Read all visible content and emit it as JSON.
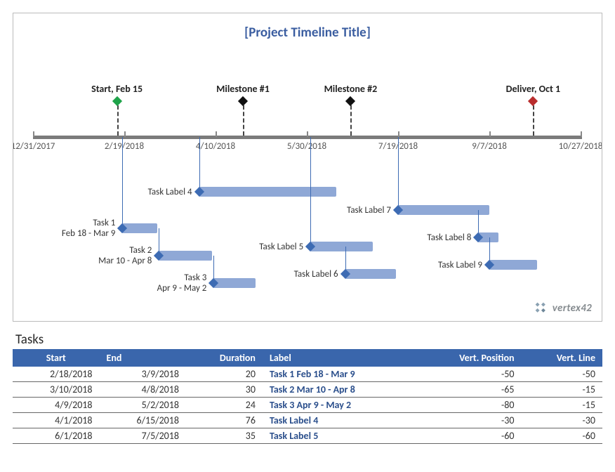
{
  "chart": {
    "title": "[Project Timeline Title]"
  },
  "chart_data": {
    "type": "bar",
    "title": "[Project Timeline Title]",
    "x_axis": {
      "min": "12/31/2017",
      "max": "10/27/2018",
      "ticks": [
        "12/31/2017",
        "2/19/2018",
        "4/10/2018",
        "5/30/2018",
        "7/19/2018",
        "9/7/2018",
        "10/27/2018"
      ]
    },
    "milestones": [
      {
        "label": "Start, Feb 15",
        "date": "2/15/2018",
        "marker": "green"
      },
      {
        "label": "Milestone #1",
        "date": "4/25/2018",
        "marker": "black"
      },
      {
        "label": "Milestone #2",
        "date": "6/23/2018",
        "marker": "black"
      },
      {
        "label": "Deliver, Oct 1",
        "date": "10/1/2018",
        "marker": "red"
      }
    ],
    "tasks": [
      {
        "label": "Task 1\nFeb 18 - Mar 9",
        "start": "2/18/2018",
        "end": "3/9/2018",
        "vpos": -50,
        "vline": -50
      },
      {
        "label": "Task 2\nMar 10 - Apr 8",
        "start": "3/10/2018",
        "end": "4/8/2018",
        "vpos": -65,
        "vline": -15
      },
      {
        "label": "Task 3\nApr 9 - May 2",
        "start": "4/9/2018",
        "end": "5/2/2018",
        "vpos": -80,
        "vline": -15
      },
      {
        "label": "Task Label 4",
        "start": "4/1/2018",
        "end": "6/15/2018",
        "vpos": -30,
        "vline": -30
      },
      {
        "label": "Task Label 5",
        "start": "6/1/2018",
        "end": "7/5/2018",
        "vpos": -60,
        "vline": -60
      },
      {
        "label": "Task Label 6",
        "start": "6/20/2018",
        "end": "7/18/2018",
        "vpos": -75,
        "vline": -15
      },
      {
        "label": "Task Label 7",
        "start": "7/19/2018",
        "end": "9/7/2018",
        "vpos": -40,
        "vline": -40
      },
      {
        "label": "Task Label 8",
        "start": "9/1/2018",
        "end": "9/12/2018",
        "vpos": -55,
        "vline": -15
      },
      {
        "label": "Task Label 9",
        "start": "9/7/2018",
        "end": "10/3/2018",
        "vpos": -70,
        "vline": -15
      }
    ],
    "brand": "vertex42"
  },
  "tasks_table": {
    "title": "Tasks",
    "headers": {
      "start": "Start",
      "end": "End",
      "duration": "Duration",
      "label": "Label",
      "vpos": "Vert. Position",
      "vline": "Vert. Line"
    },
    "rows": [
      {
        "start": "2/18/2018",
        "end": "3/9/2018",
        "duration": "20",
        "label": "Task 1   Feb 18 - Mar 9",
        "vpos": "-50",
        "vline": "-50"
      },
      {
        "start": "3/10/2018",
        "end": "4/8/2018",
        "duration": "30",
        "label": "Task 2   Mar 10 - Apr 8",
        "vpos": "-65",
        "vline": "-15"
      },
      {
        "start": "4/9/2018",
        "end": "5/2/2018",
        "duration": "24",
        "label": "Task 3   Apr 9 - May 2",
        "vpos": "-80",
        "vline": "-15"
      },
      {
        "start": "4/1/2018",
        "end": "6/15/2018",
        "duration": "76",
        "label": "Task Label 4",
        "vpos": "-30",
        "vline": "-30"
      },
      {
        "start": "6/1/2018",
        "end": "7/5/2018",
        "duration": "35",
        "label": "Task Label 5",
        "vpos": "-60",
        "vline": "-60"
      }
    ]
  }
}
